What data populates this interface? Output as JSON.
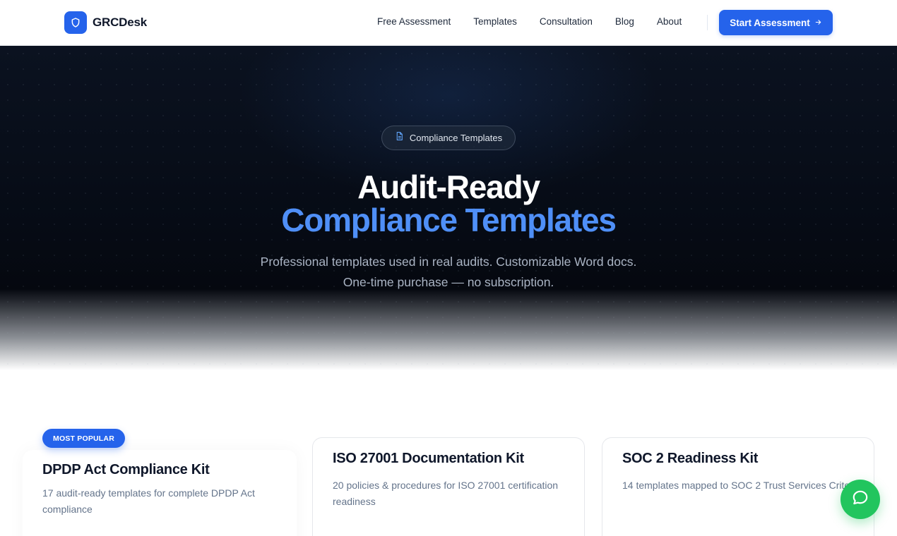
{
  "nav": {
    "brand": "GRCDesk",
    "links": [
      "Free Assessment",
      "Templates",
      "Consultation",
      "Blog",
      "About"
    ],
    "cta": "Start Assessment",
    "cta_icon": "arrow-right-icon"
  },
  "hero": {
    "pill": "Compliance Templates",
    "pill_icon": "document-icon",
    "title_line1": "Audit-Ready",
    "title_line2": "Compliance Templates",
    "subtitle_line1": "Professional templates used in real audits. Customizable Word docs.",
    "subtitle_line2": "One-time purchase — no subscription."
  },
  "cards": [
    {
      "badge": "MOST POPULAR",
      "title": "DPDP Act Compliance Kit",
      "description": "17 audit-ready templates for complete DPDP Act compliance"
    },
    {
      "title": "ISO 27001 Documentation Kit",
      "description": "20 policies & procedures for ISO 27001 certification readiness"
    },
    {
      "title": "SOC 2 Readiness Kit",
      "description": "14 templates mapped to SOC 2 Trust Services Criteria"
    }
  ],
  "colors": {
    "accent": "#2563eb",
    "title_blue": "#4f8ff7",
    "chat": "#22c55e",
    "hero_bg": "#0b1220"
  },
  "chat_icon": "chat-bubble-icon"
}
